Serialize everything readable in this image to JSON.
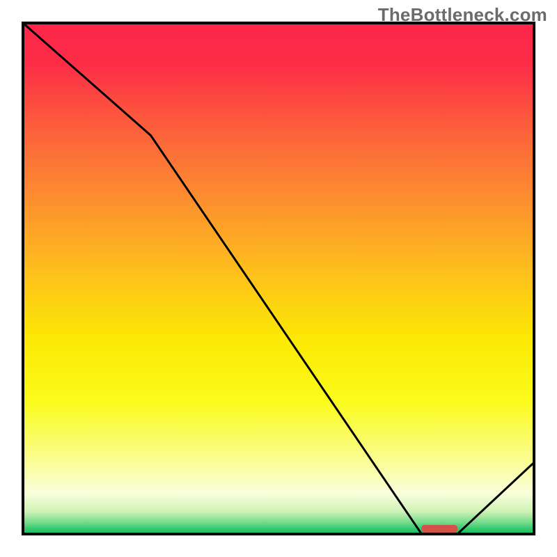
{
  "watermark": {
    "text": "TheBottleneck.com"
  },
  "chart_data": {
    "type": "line",
    "title": "",
    "xlabel": "",
    "ylabel": "",
    "xlim": [
      0,
      100
    ],
    "ylim": [
      0,
      100
    ],
    "series": [
      {
        "name": "bottleneck-curve",
        "x": [
          0,
          25,
          78,
          85,
          100
        ],
        "y": [
          100,
          78,
          0,
          0,
          14
        ]
      }
    ],
    "marker": {
      "name": "optimal-range",
      "x_range": [
        78,
        85
      ],
      "y": 0,
      "color": "#d2524a"
    },
    "background_gradient": {
      "stops": [
        {
          "offset": 0.0,
          "color": "#fc2649"
        },
        {
          "offset": 0.08,
          "color": "#fc2d47"
        },
        {
          "offset": 0.2,
          "color": "#fc5d3c"
        },
        {
          "offset": 0.35,
          "color": "#fd902e"
        },
        {
          "offset": 0.5,
          "color": "#fdc41a"
        },
        {
          "offset": 0.62,
          "color": "#fce904"
        },
        {
          "offset": 0.74,
          "color": "#fbfb1c"
        },
        {
          "offset": 0.85,
          "color": "#fafd8b"
        },
        {
          "offset": 0.92,
          "color": "#f9fedb"
        },
        {
          "offset": 0.955,
          "color": "#d1f3b6"
        },
        {
          "offset": 0.975,
          "color": "#7fdd91"
        },
        {
          "offset": 0.99,
          "color": "#33c86e"
        },
        {
          "offset": 1.0,
          "color": "#16bf60"
        }
      ]
    },
    "frame": {
      "inset": 33
    }
  }
}
